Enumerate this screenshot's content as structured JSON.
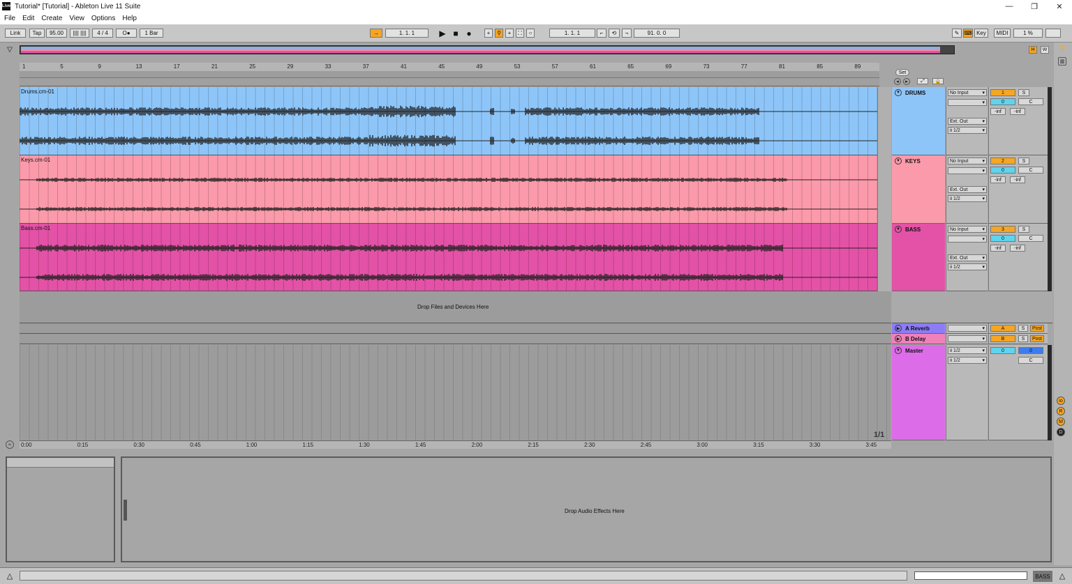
{
  "window": {
    "title": "Tutorial*  [Tutorial] - Ableton Live 11 Suite",
    "app_icon": "Live",
    "controls": [
      "—",
      "❐",
      "✕"
    ]
  },
  "menu": [
    "File",
    "Edit",
    "Create",
    "View",
    "Options",
    "Help"
  ],
  "control_bar": {
    "link": "Link",
    "tap": "Tap",
    "tempo": "95.00",
    "time_signature": "4 / 4",
    "metronome": "O●",
    "quantization": "1 Bar",
    "arrangement_position": "1.   1.   1",
    "loop_start": "1.   1.   1",
    "loop_length": "91.   0.   0",
    "key": "Key",
    "midi": "MIDI",
    "cpu": "1 %"
  },
  "ruler": {
    "bars": [
      "1",
      "5",
      "9",
      "13",
      "17",
      "21",
      "25",
      "29",
      "33",
      "37",
      "41",
      "45",
      "49",
      "53",
      "57",
      "61",
      "65",
      "69",
      "73",
      "77",
      "81",
      "85",
      "89"
    ],
    "set_label": "Set"
  },
  "time_ruler": [
    "0:00",
    "0:15",
    "0:30",
    "0:45",
    "1:00",
    "1:15",
    "1:30",
    "1:45",
    "2:00",
    "2:15",
    "2:30",
    "2:45",
    "3:00",
    "3:15",
    "3:30",
    "3:45"
  ],
  "zoom_label": "1/1",
  "tracks": [
    {
      "clip": "Drums.cm-01",
      "name": "DRUMS",
      "color": "#8ec5f8",
      "head_color": "#8ec5f8",
      "input": "No Input",
      "output": "Ext. Out",
      "channel": "ii 1/2",
      "number": "1",
      "solo": "S",
      "volume": "0",
      "pan": "C",
      "peak_l": "-inf",
      "peak_r": "-inf"
    },
    {
      "clip": "Keys.cm-01",
      "name": "KEYS",
      "color": "#fb9aaa",
      "head_color": "#fb9aaa",
      "input": "No Input",
      "output": "Ext. Out",
      "channel": "ii 1/2",
      "number": "2",
      "solo": "S",
      "volume": "0",
      "pan": "C",
      "peak_l": "-inf",
      "peak_r": "-inf"
    },
    {
      "clip": "Bass.cm-01",
      "name": "BASS",
      "color": "#e352a6",
      "head_color": "#e352a6",
      "input": "No Input",
      "output": "Ext. Out",
      "channel": "ii 1/2",
      "number": "3",
      "solo": "S",
      "volume": "0",
      "pan": "C",
      "peak_l": "-inf",
      "peak_r": "-inf"
    }
  ],
  "drop_files": "Drop Files and Devices Here",
  "returns": [
    {
      "name": "A Reverb",
      "color": "#8d7cf5",
      "send": "A",
      "solo": "S",
      "post": "Post"
    },
    {
      "name": "B Delay",
      "color": "#f080ba",
      "send": "B",
      "solo": "S",
      "post": "Post"
    }
  ],
  "master": {
    "name": "Master",
    "color": "#dd6ce8",
    "cue": "ii 1/2",
    "out": "ii 1/2",
    "volume": "0",
    "cue_volume": "0",
    "pan": "C"
  },
  "detail": {
    "drop_effects": "Drop Audio Effects Here"
  },
  "status": {
    "selected_track": "BASS"
  },
  "side_icons": [
    "io",
    "R",
    "M",
    "D"
  ]
}
